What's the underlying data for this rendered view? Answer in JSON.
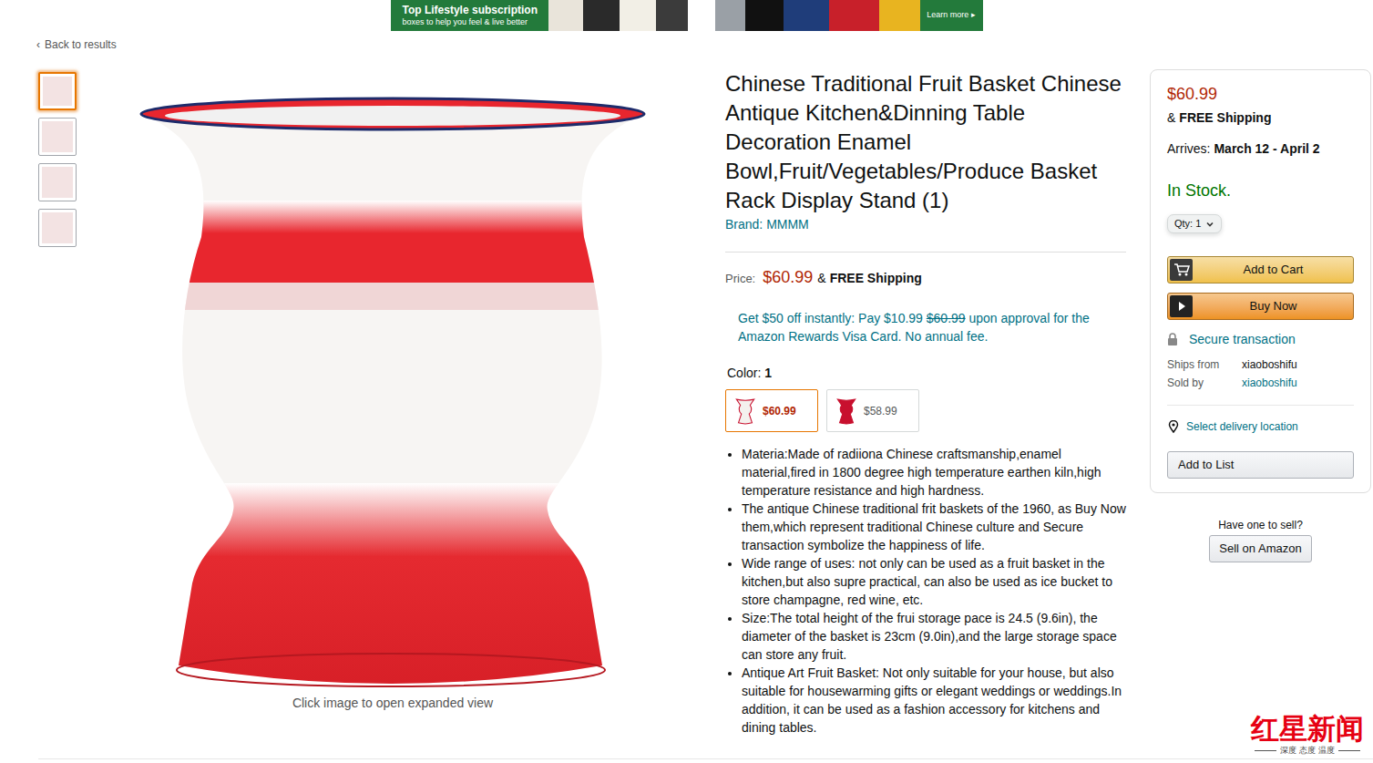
{
  "ad_banner": {
    "headline": "Top Lifestyle subscription",
    "subline": "boxes to help you feel & live better",
    "cta": "Learn more ▸"
  },
  "back_link": {
    "icon": "‹",
    "label": "Back to results"
  },
  "thumbnails": [
    {
      "selected": true
    },
    {
      "selected": false
    },
    {
      "selected": false
    },
    {
      "selected": false
    }
  ],
  "main_image": {
    "caption": "Click image to open expanded view"
  },
  "product": {
    "title": "Chinese Traditional Fruit Basket Chinese Antique Kitchen&Dinning Table Decoration Enamel Bowl,Fruit/Vegetables/Produce Basket Rack Display Stand (1)",
    "brand": "Brand: MMMM"
  },
  "price": {
    "label": "Price:",
    "amount": "$60.99",
    "prefix": "&",
    "shipping": "FREE Shipping"
  },
  "promo": {
    "before": "Get $50 off instantly: Pay $10.99",
    "struck": "$60.99",
    "after": "upon approval for the Amazon Rewards Visa Card. No annual fee."
  },
  "color_selector": {
    "label": "Color:",
    "value": "1",
    "options": [
      {
        "price": "$60.99",
        "selected": true,
        "color": "#f4f1ee"
      },
      {
        "price": "$58.99",
        "selected": false,
        "color": "#c8102e"
      }
    ]
  },
  "bullets": [
    "Materia:Made of radiiona Chinese craftsmanship,enamel material,fired in 1800 degree high temperature earthen kiln,high temperature resistance and high hardness.",
    "The antique Chinese traditional frit baskets of the 1960, as Buy Now them,which represent traditional Chinese culture and Secure transaction symbolize the happiness of life.",
    "Wide range of uses: not only can be used as a fruit basket in the kitchen,but also supre practical, can also be used as ice bucket to store champagne, red wine, etc.",
    "Size:The total height of the frui storage pace is 24.5 (9.6in), the diameter of the basket is 23cm (9.0in),and the large storage space can store any fruit.",
    "Antique Art Fruit Basket: Not only suitable for your house, but also suitable for housewarming gifts or elegant weddings or weddings.In addition, it can be used as a fashion accessory for kitchens and dining tables."
  ],
  "buy_box": {
    "price": "$60.99",
    "prefix": "&",
    "shipping": "FREE Shipping",
    "arrives_label": "Arrives:",
    "arrives_dates": "March 12 - April 2",
    "stock": "In Stock.",
    "qty_label": "Qty:",
    "qty_value": "1",
    "add_to_cart": "Add to Cart",
    "buy_now": "Buy Now",
    "secure": "Secure transaction",
    "ships_from_label": "Ships from",
    "ships_from": "xiaoboshifu",
    "sold_by_label": "Sold by",
    "sold_by": "xiaoboshifu",
    "delivery": "Select delivery location",
    "add_to_list": "Add to List"
  },
  "sell": {
    "prompt": "Have one to sell?",
    "button": "Sell on Amazon"
  },
  "watermark": {
    "logo": "红星新闻",
    "tagline": "深度 态度 温度"
  }
}
